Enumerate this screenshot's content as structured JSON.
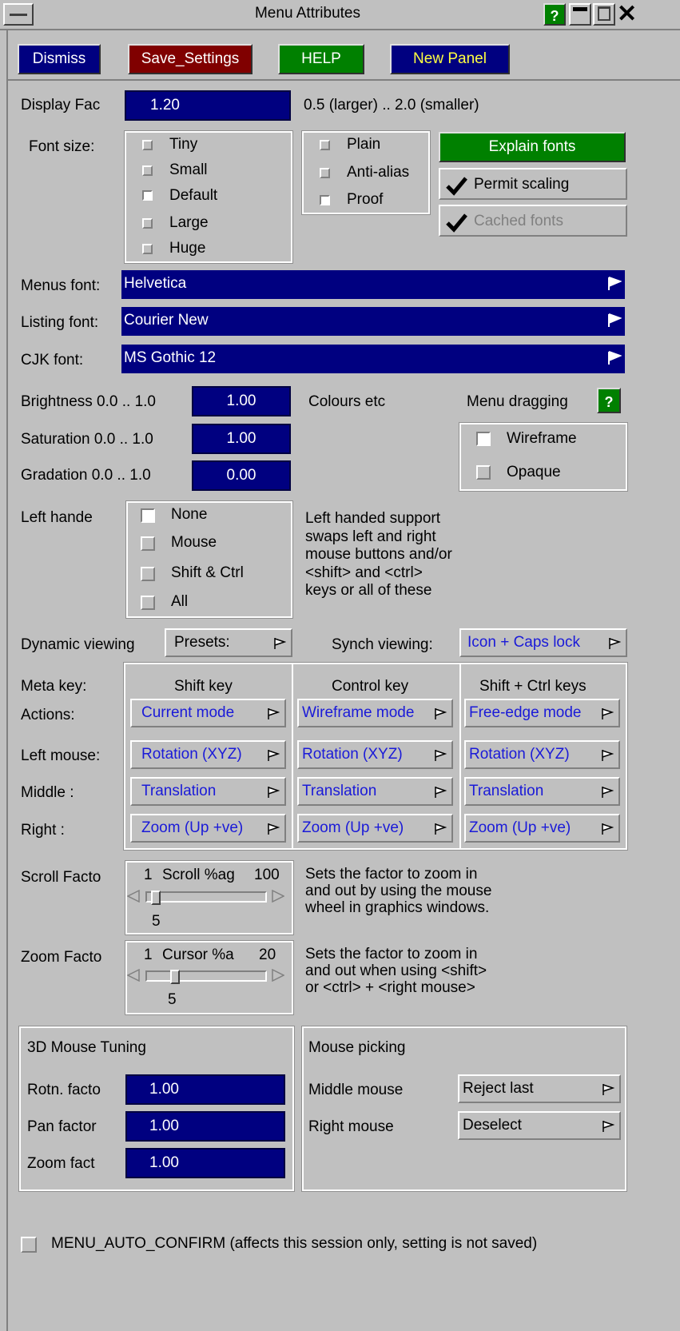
{
  "window": {
    "title": "Menu Attributes",
    "help": "?"
  },
  "toolbar": {
    "dismiss": "Dismiss",
    "save": "Save_Settings",
    "help": "HELP",
    "new_panel": "New Panel"
  },
  "display": {
    "label": "Display Fac",
    "value": "1.20",
    "hint": "0.5 (larger) .. 2.0 (smaller)"
  },
  "font_size": {
    "label": "Font size:",
    "options": [
      "Tiny",
      "Small",
      "Default",
      "Large",
      "Huge"
    ],
    "selected": "Default"
  },
  "render": {
    "options": [
      "Plain",
      "Anti-alias",
      "Proof"
    ],
    "selected": "Proof"
  },
  "fonts_btn": "Explain fonts",
  "permit_scaling": {
    "label": "Permit scaling",
    "checked": true
  },
  "cached_fonts": {
    "label": "Cached fonts",
    "checked": true
  },
  "menus_font": {
    "label": "Menus font:",
    "value": "Helvetica"
  },
  "listing_font": {
    "label": "Listing font:",
    "value": "Courier New"
  },
  "cjk_font": {
    "label": "CJK font:",
    "value": "MS Gothic 12"
  },
  "colours": {
    "brightness": {
      "label": "Brightness 0.0 .. 1.0",
      "value": "1.00"
    },
    "saturation": {
      "label": "Saturation 0.0 .. 1.0",
      "value": "1.00"
    },
    "gradation": {
      "label": "Gradation  0.0 .. 1.0",
      "value": "0.00"
    },
    "note": "Colours etc"
  },
  "menu_dragging": {
    "label": "Menu dragging",
    "help": "?",
    "options": [
      "Wireframe",
      "Opaque"
    ],
    "selected": "Wireframe"
  },
  "left_hand": {
    "label": "Left hande",
    "options": [
      "None",
      "Mouse",
      "Shift & Ctrl",
      "All"
    ],
    "selected": "None",
    "description": [
      "Left handed support",
      "swaps left and right",
      "mouse buttons and/or",
      "<shift> and <ctrl>",
      "keys or all of these"
    ]
  },
  "dynamic_viewing": {
    "label": "Dynamic viewing",
    "value": "Presets:"
  },
  "synch_viewing": {
    "label": "Synch viewing:",
    "value": "Icon + Caps lock"
  },
  "meta": {
    "label": "Meta key:",
    "columns": [
      "Shift key",
      "Control key",
      "Shift + Ctrl keys"
    ],
    "rows": [
      {
        "label": "Actions:",
        "values": [
          "Current mode",
          "Wireframe mode",
          "Free-edge mode"
        ]
      },
      {
        "label": "Left mouse:",
        "values": [
          "Rotation (XYZ)",
          "Rotation (XYZ)",
          "Rotation (XYZ)"
        ]
      },
      {
        "label": "Middle :",
        "values": [
          "Translation",
          "Translation",
          "Translation"
        ]
      },
      {
        "label": "Right :",
        "values": [
          "Zoom (Up +ve)",
          "Zoom (Up +ve)",
          "Zoom (Up +ve)"
        ]
      }
    ]
  },
  "scroll_factor": {
    "label": "Scroll Facto",
    "min": "1",
    "title": "Scroll %ag",
    "max": "100",
    "value": "5",
    "fraction": 0.04,
    "description": [
      "Sets the factor to zoom in",
      "and out by using the mouse",
      "wheel in graphics windows."
    ]
  },
  "zoom_factor": {
    "label": "Zoom Facto",
    "min": "1",
    "title": "Cursor %a",
    "max": "20",
    "value": "5",
    "fraction": 0.21,
    "description": [
      "Sets the factor to zoom in",
      "and out when using <shift>",
      "or <ctrl> + <right mouse>"
    ]
  },
  "mouse3d": {
    "title": "3D Mouse Tuning",
    "rotn": {
      "label": "Rotn. facto",
      "value": "1.00"
    },
    "pan": {
      "label": "Pan factor",
      "value": "1.00"
    },
    "zoom": {
      "label": "Zoom fact",
      "value": "1.00"
    }
  },
  "picking": {
    "title": "Mouse picking",
    "middle": {
      "label": "Middle mouse",
      "value": "Reject last"
    },
    "right": {
      "label": "Right mouse",
      "value": "Deselect"
    }
  },
  "auto_confirm": {
    "label": "MENU_AUTO_CONFIRM  (affects this session only, setting is not saved)",
    "checked": false
  }
}
